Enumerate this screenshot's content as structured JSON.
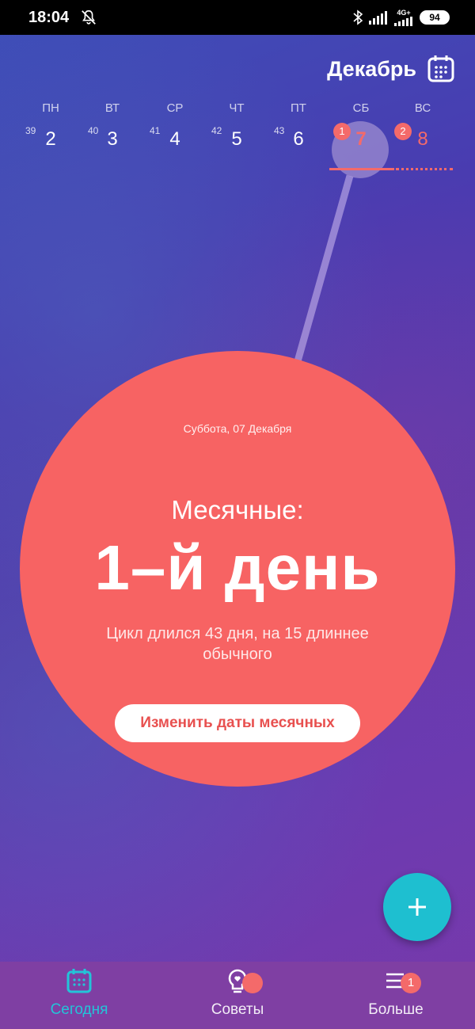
{
  "status_bar": {
    "time": "18:04",
    "network": "4G+",
    "battery": "94"
  },
  "header": {
    "month": "Декабрь"
  },
  "week": {
    "days": [
      {
        "name": "ПН",
        "week_num": "39",
        "num": "2"
      },
      {
        "name": "ВТ",
        "week_num": "40",
        "num": "3"
      },
      {
        "name": "СР",
        "week_num": "41",
        "num": "4"
      },
      {
        "name": "ЧТ",
        "week_num": "42",
        "num": "5"
      },
      {
        "name": "ПТ",
        "week_num": "43",
        "num": "6"
      },
      {
        "name": "СБ",
        "badge": "1",
        "num": "7"
      },
      {
        "name": "ВС",
        "badge": "2",
        "num": "8"
      }
    ]
  },
  "circle": {
    "date": "Суббота, 07 Декабря",
    "label": "Месячные:",
    "day": "1–й день",
    "description": "Цикл длился 43 дня, на 15 длиннее обычного",
    "edit_button": "Изменить даты месячных"
  },
  "fab": {
    "icon": "plus-icon"
  },
  "nav": {
    "today": "Сегодня",
    "tips": "Советы",
    "more": "Больше",
    "more_badge": "1"
  },
  "colors": {
    "accent": "#f76363",
    "teal": "#1ebfd0",
    "nav_bg": "#7f3fa3"
  }
}
